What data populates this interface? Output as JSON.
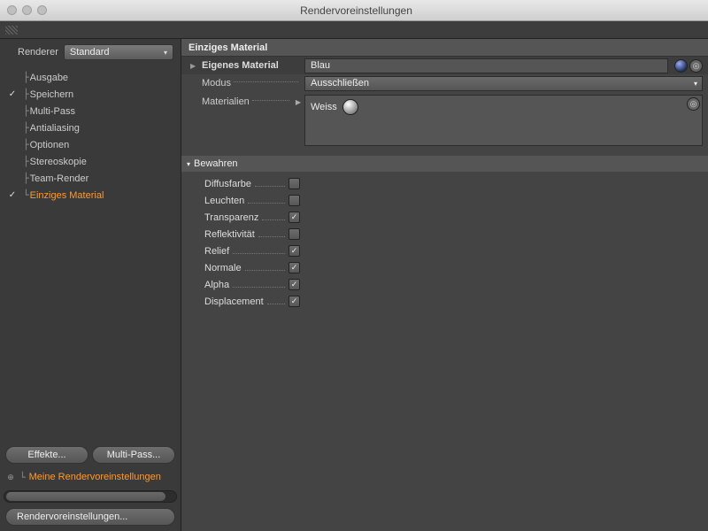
{
  "window": {
    "title": "Rendervoreinstellungen"
  },
  "sidebar": {
    "renderer_label": "Renderer",
    "renderer_value": "Standard",
    "items": [
      {
        "checked": "",
        "label": "Ausgabe",
        "active": false
      },
      {
        "checked": "✓",
        "label": "Speichern",
        "active": false
      },
      {
        "checked": "",
        "label": "Multi-Pass",
        "active": false
      },
      {
        "checked": "",
        "label": "Antialiasing",
        "active": false,
        "nochk": true
      },
      {
        "checked": "",
        "label": "Optionen",
        "active": false,
        "nochk": true
      },
      {
        "checked": "",
        "label": "Stereoskopie",
        "active": false
      },
      {
        "checked": "",
        "label": "Team-Render",
        "active": false,
        "nochk": true
      },
      {
        "checked": "✓",
        "label": "Einziges Material",
        "active": true
      }
    ],
    "effects_btn": "Effekte...",
    "multipass_btn": "Multi-Pass...",
    "preset": "Meine Rendervoreinstellungen",
    "bottom_btn": "Rendervoreinstellungen..."
  },
  "panel": {
    "title": "Einziges Material",
    "own_material_label": "Eigenes Material",
    "own_material_value": "Blau",
    "mode_label": "Modus",
    "mode_value": "Ausschließen",
    "materials_label": "Materialien",
    "materials_item": "Weiss",
    "preserve_section": "Bewahren",
    "props": [
      {
        "name": "Diffusfarbe",
        "checked": false
      },
      {
        "name": "Leuchten",
        "checked": false
      },
      {
        "name": "Transparenz",
        "checked": true
      },
      {
        "name": "Reflektivität",
        "checked": false
      },
      {
        "name": "Relief",
        "checked": true
      },
      {
        "name": "Normale",
        "checked": true
      },
      {
        "name": "Alpha",
        "checked": true
      },
      {
        "name": "Displacement",
        "checked": true
      }
    ]
  }
}
